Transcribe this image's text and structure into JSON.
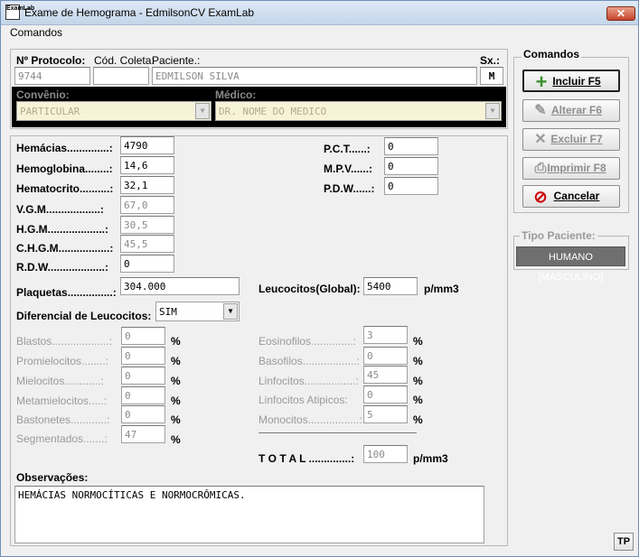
{
  "window": {
    "title": "Exame de Hemograma - EdmilsonCV ExamLab",
    "close": "✕",
    "app_icon": "ExamLab"
  },
  "menu": {
    "comandos": "Comandos"
  },
  "header": {
    "protocolo_label": "Nº Protocolo:",
    "protocolo_value": "9744",
    "coleta_label": "Cód. Coleta:",
    "coleta_value": "",
    "paciente_label": "Paciente.:",
    "paciente_value": "EDMILSON SILVA",
    "sexo_label": "Sx.:",
    "sexo_value": "M",
    "convenio_label": "Convênio:",
    "convenio_value": "PARTICULAR",
    "medico_label": "Médico:",
    "medico_value": "DR. NOME DO MEDICO"
  },
  "hemo": {
    "hemacias_label": "Hemácias..............:",
    "hemacias_value": "4790",
    "hemoglobina_label": "Hemoglobina........:",
    "hemoglobina_value": "14,6",
    "hematocrito_label": "Hematocrito..........:",
    "hematocrito_value": "32,1",
    "vgm_label": "V.G.M..................:",
    "vgm_value": "67,0",
    "hgm_label": "H.G.M...................:",
    "hgm_value": "30,5",
    "chgm_label": "C.H.G.M.................:",
    "chgm_value": "45,5",
    "rdw_label": "R.D.W...................:",
    "rdw_value": "0",
    "pct_label": "P.C.T......:",
    "pct_value": "0",
    "mpv_label": "M.P.V......:",
    "mpv_value": "0",
    "pdw_label": "P.D.W......:",
    "pdw_value": "0",
    "plaquetas_label": "Plaquetas...............:",
    "plaquetas_value": "304.000",
    "leucocitos_label": "Leucocitos(Global):",
    "leucocitos_value": "5400",
    "leucocitos_unit": "p/mm3",
    "diferencial_label": "Diferencial de Leucocitos:",
    "diferencial_value": "SIM"
  },
  "left_diff": [
    {
      "label": "Blastos...................:",
      "value": "0",
      "unit": "%"
    },
    {
      "label": "Promielocitos........:",
      "value": "0",
      "unit": "%"
    },
    {
      "label": "Mielocitos............:",
      "value": "0",
      "unit": "%"
    },
    {
      "label": "Metamielocitos.....:",
      "value": "0",
      "unit": "%"
    },
    {
      "label": "Bastonetes............:",
      "value": "0",
      "unit": "%"
    },
    {
      "label": "Segmentados.......:",
      "value": "47",
      "unit": "%"
    }
  ],
  "right_diff": [
    {
      "label": "Eosinofilos..............:",
      "value": "3",
      "unit": "%"
    },
    {
      "label": "Basofilos..................:",
      "value": "0",
      "unit": "%"
    },
    {
      "label": "Linfocitos.................:",
      "value": "45",
      "unit": "%"
    },
    {
      "label": "Linfocitos  Atipicos:",
      "value": "0",
      "unit": "%"
    },
    {
      "label": "Monocitos.................:",
      "value": "5",
      "unit": "%"
    }
  ],
  "total": {
    "label": "T O T A L ..............:",
    "value": "100",
    "unit": "p/mm3"
  },
  "obs": {
    "label": "Observações:",
    "value": "HEMÁCIAS NORMOCÍTICAS E NORMOCRÔMICAS."
  },
  "commands": {
    "title": "Comandos",
    "incluir": "Incluir  F5",
    "alterar": "Alterar  F6",
    "excluir": "Excluir  F7",
    "imprimir": "Imprimir  F8",
    "cancelar": "Cancelar"
  },
  "tipo": {
    "title": "Tipo Paciente:",
    "value": "HUMANO [MASCULINO]"
  },
  "tp_button": "TP",
  "colors": {
    "accent": "#3a8f2e",
    "cancel": "#cc0000",
    "dark_panel": "#000000",
    "tipo_box": "#6f6f6f"
  }
}
